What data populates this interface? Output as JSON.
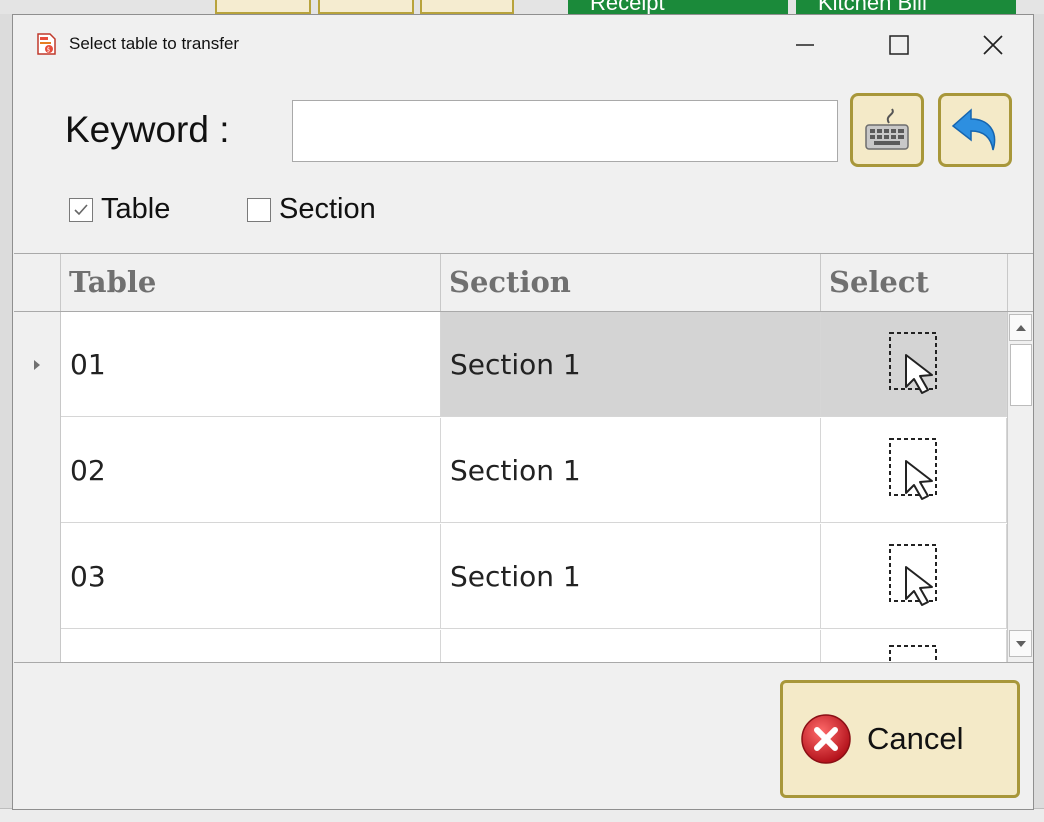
{
  "background": {
    "tabs": [
      "Receipt",
      "Kitchen Bill"
    ]
  },
  "dialog": {
    "title": "Select table to transfer",
    "icons": {
      "app": "app-icon",
      "minimize": "minimize-icon",
      "maximize": "maximize-icon",
      "close": "close-icon"
    }
  },
  "search": {
    "label": "Keyword :",
    "value": "",
    "placeholder": "",
    "keyboard_icon": "keyboard-icon",
    "back_icon": "back-arrow-icon"
  },
  "filters": [
    {
      "label": "Table",
      "checked": true
    },
    {
      "label": "Section",
      "checked": false
    }
  ],
  "grid": {
    "columns": [
      "Table",
      "Section",
      "Select"
    ],
    "rows": [
      {
        "table": "01",
        "section": "Section 1",
        "selected": true
      },
      {
        "table": "02",
        "section": "Section 1",
        "selected": false
      },
      {
        "table": "03",
        "section": "Section 1",
        "selected": false
      },
      {
        "table": "",
        "section": "",
        "selected": false
      }
    ]
  },
  "footer": {
    "cancel_label": "Cancel",
    "cancel_icon": "cancel-icon"
  }
}
